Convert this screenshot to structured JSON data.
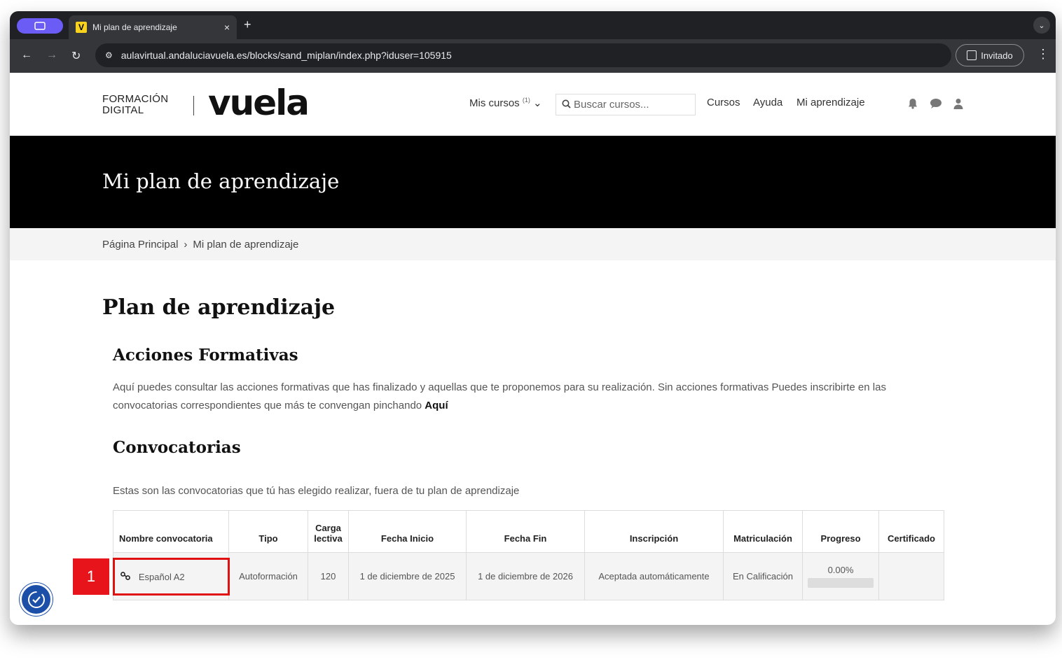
{
  "browser": {
    "tab_title": "Mi plan de aprendizaje",
    "tab_favicon_letter": "V",
    "tab_close": "×",
    "new_tab": "+",
    "url": "aulavirtual.andaluciavuela.es/blocks/sand_miplan/index.php?iduser=105915",
    "guest_label": "Invitado",
    "menu_glyph": "⋮",
    "back": "←",
    "forward": "→",
    "reload": "↻",
    "site_info": "⚙",
    "tab_menu": "⌄"
  },
  "header": {
    "logo_line1": "FORMACIÓN",
    "logo_line2": "DIGITAL",
    "logo_main": "vuela",
    "mis_cursos": "Mis cursos",
    "mis_cursos_count": "(1)",
    "mis_cursos_chevron": "⌄",
    "search_placeholder": "Buscar cursos...",
    "search_icon": "⚲",
    "nav": [
      "Cursos",
      "Ayuda",
      "Mi aprendizaje"
    ],
    "icons": [
      "bell-icon",
      "chat-icon",
      "user-icon"
    ],
    "icon_glyphs": [
      "🔔",
      "💬",
      "👤"
    ]
  },
  "banner": {
    "title": "Mi plan de aprendizaje"
  },
  "breadcrumb": {
    "home": "Página Principal",
    "separator": "›",
    "current": "Mi plan de aprendizaje"
  },
  "main": {
    "title": "Plan de aprendizaje",
    "acciones_title": "Acciones Formativas",
    "acciones_text": "Aquí puedes consultar las acciones formativas que has finalizado y aquellas que te proponemos para su realización. Sin acciones formativas Puedes inscribirte en las convocatorias correspondientes que más te convengan pinchando",
    "acciones_link": "Aquí",
    "convocatorias_title": "Convocatorias",
    "convocatorias_text": "Estas son las convocatorias que tú has elegido realizar, fuera de tu plan de aprendizaje"
  },
  "table": {
    "headers": [
      "Nombre convocatoria",
      "Tipo",
      "Carga lectiva",
      "Fecha Inicio",
      "Fecha Fin",
      "Inscripción",
      "Matriculación",
      "Progreso",
      "Certificado"
    ],
    "header_carga_line1": "Carga",
    "header_carga_line2": "lectiva",
    "rows": [
      {
        "nombre": "Español A2",
        "tipo": "Autoformación",
        "carga": "120",
        "inicio": "1 de diciembre de 2025",
        "fin": "1 de diciembre de 2026",
        "inscripcion": "Aceptada automáticamente",
        "matriculacion": "En Calificación",
        "progreso_label": "0.00%",
        "progreso": 0,
        "certificado": ""
      }
    ]
  },
  "annotation": {
    "step": "1",
    "highlight_color": "#e01010"
  },
  "colors": {
    "accent_purple": "#6b5cf6",
    "favicon_yellow": "#f7d21e",
    "a11y_blue": "#1b4fa8"
  }
}
